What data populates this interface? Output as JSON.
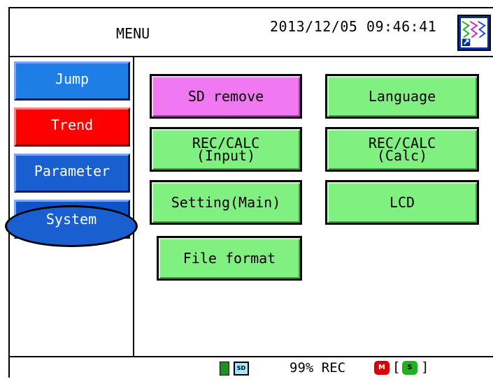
{
  "header": {
    "title": "MENU",
    "datetime": "2013/12/05 09:46:41",
    "display_icon": "trend-display-icon"
  },
  "sidebar": {
    "items": [
      {
        "label": "Jump",
        "color": "#1e7ee6"
      },
      {
        "label": "Trend",
        "color": "#ff0000"
      },
      {
        "label": "Parameter",
        "color": "#1a5fd0"
      },
      {
        "label": "System",
        "color": "#0e54c8"
      }
    ]
  },
  "main": {
    "buttons": [
      {
        "label": "SD remove",
        "color": "#f078f0"
      },
      {
        "label": "Language",
        "color": "#80f080"
      },
      {
        "label": "REC/CALC\n(Input)",
        "color": "#80f080"
      },
      {
        "label": "REC/CALC\n(Calc)",
        "color": "#80f080"
      },
      {
        "label": "Setting(Main)",
        "color": "#80f080"
      },
      {
        "label": "LCD",
        "color": "#80f080"
      },
      {
        "label": "File format",
        "color": "#80f080"
      }
    ]
  },
  "status": {
    "battery_icon": "battery-icon",
    "sd_label": "SD",
    "text": "99% REC",
    "m_label": "M",
    "s_label": "S",
    "open_bracket": "[",
    "close_bracket": "]"
  }
}
